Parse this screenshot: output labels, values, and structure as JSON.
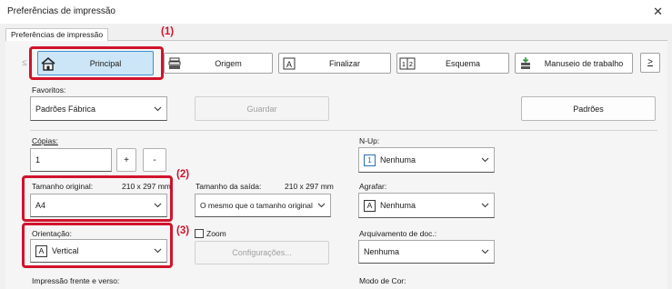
{
  "window": {
    "title": "Preferências de impressão"
  },
  "tab": {
    "label": "Preferências de impressão"
  },
  "toolbar": {
    "scroll_left": "≤",
    "scroll_right": ">",
    "items": [
      {
        "label": "Principal",
        "icon": "home-icon"
      },
      {
        "label": "Origem",
        "icon": "paper-tray-icon"
      },
      {
        "label": "Finalizar",
        "icon": "finish-icon"
      },
      {
        "label": "Esquema",
        "icon": "layout-icon"
      },
      {
        "label": "Manuseio de trabalho",
        "icon": "job-handling-icon"
      }
    ]
  },
  "callouts": {
    "c1": "(1)",
    "c2": "(2)",
    "c3": "(3)"
  },
  "favorites": {
    "label": "Favoritos:",
    "value": "Padrões Fábrica",
    "save_button": "Guardar",
    "defaults_button": "Padrões"
  },
  "copies": {
    "label": "Cópias:",
    "value": "1",
    "plus": "+",
    "minus": "-"
  },
  "original_size": {
    "label": "Tamanho original:",
    "dims": "210 x 297 mm",
    "value": "A4"
  },
  "output_size": {
    "label": "Tamanho da saída:",
    "dims": "210 x 297 mm",
    "value": "O mesmo que o tamanho original"
  },
  "orientation": {
    "label": "Orientação:",
    "value": "Vertical",
    "icon_letter": "A"
  },
  "zoom": {
    "label": "Zoom",
    "settings_button": "Configurações..."
  },
  "duplex": {
    "label": "Impressão frente e verso:"
  },
  "nup": {
    "label": "N-Up:",
    "value": "Nenhuma",
    "icon_text": "1"
  },
  "staple": {
    "label": "Agrafar:",
    "value": "Nenhuma",
    "icon_letter": "A"
  },
  "retention": {
    "label": "Arquivamento de doc.:",
    "value": "Nenhuma"
  },
  "color_mode": {
    "label": "Modo de Cor:"
  },
  "colors": {
    "accent_red": "#d1132c",
    "selected_bg": "#cde6f7",
    "selected_border": "#3a8fd4"
  }
}
